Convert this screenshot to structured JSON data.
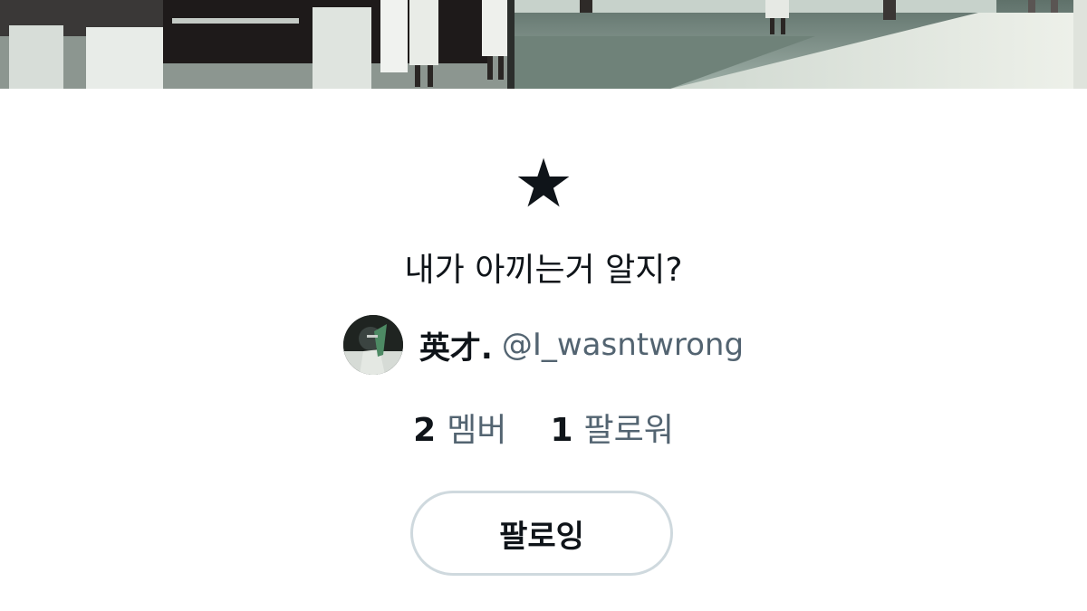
{
  "list": {
    "icon": "star-icon",
    "icon_glyph": "★",
    "title": "내가 아끼는거 알지?"
  },
  "owner": {
    "name": "英才.",
    "handle": "@I_wasntwrong"
  },
  "stats": {
    "members_count": "2",
    "members_label": "멤버",
    "followers_count": "1",
    "followers_label": "팔로워"
  },
  "follow_button": {
    "label": "팔로잉"
  },
  "colors": {
    "text_primary": "#0f1419",
    "text_secondary": "#536471",
    "button_border": "#cfd9de"
  }
}
